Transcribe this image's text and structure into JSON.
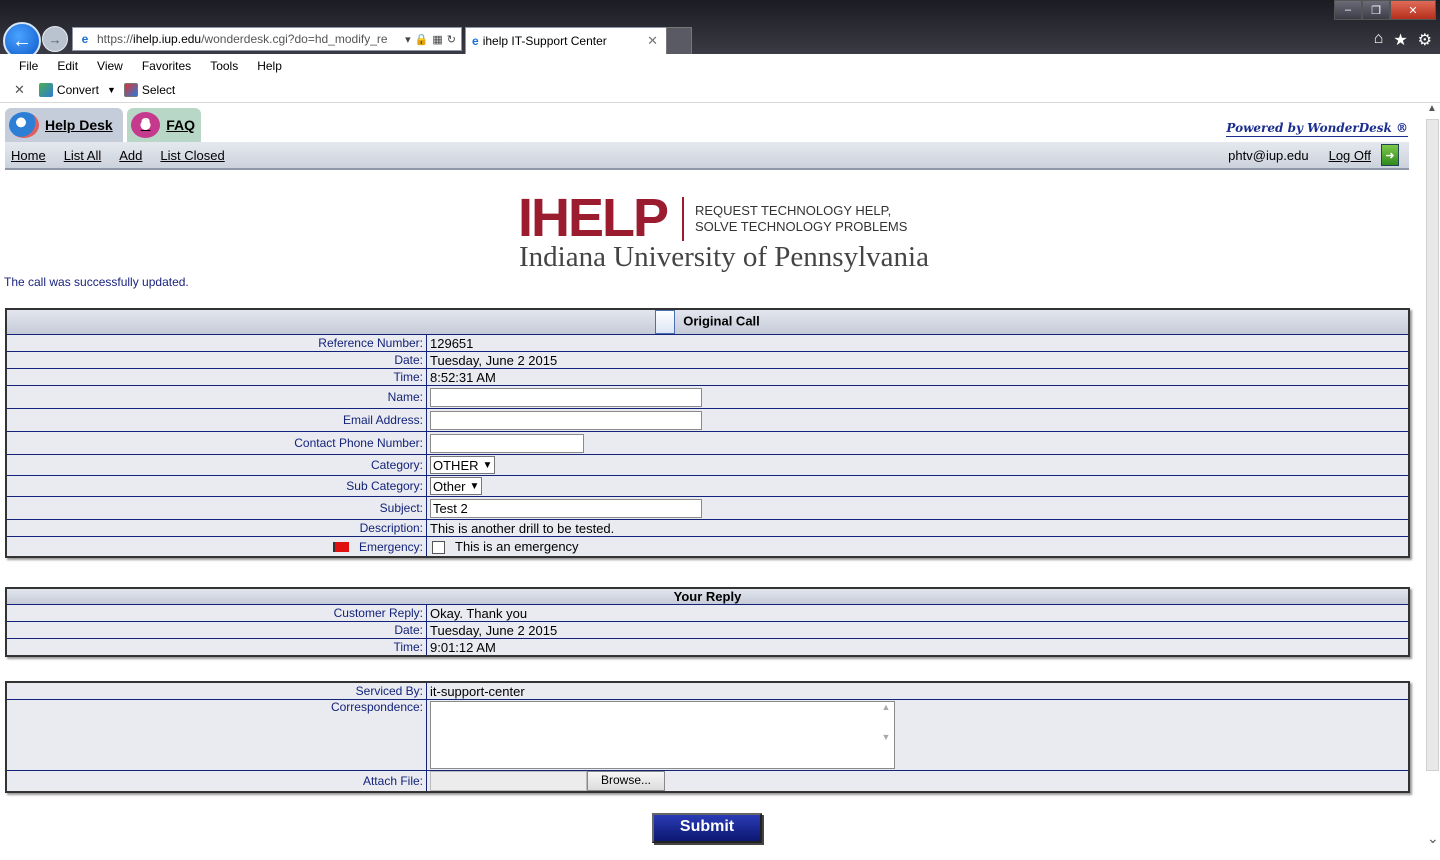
{
  "browser": {
    "url_prefix": "https://",
    "url_domain": "ihelp.iup.edu",
    "url_path": "/wonderdesk.cgi?do=hd_modify_re",
    "tab_title": "ihelp IT-Support Center",
    "menu": [
      "File",
      "Edit",
      "View",
      "Favorites",
      "Tools",
      "Help"
    ],
    "cmd": {
      "convert": "Convert",
      "select": "Select"
    }
  },
  "apptabs": {
    "helpdesk": "Help Desk",
    "faq": "FAQ"
  },
  "powered_by": "Powered by WonderDesk ®",
  "nav": {
    "home": "Home",
    "list_all": "List All",
    "add": "Add",
    "list_closed": "List Closed",
    "user": "phtv@iup.edu",
    "logoff": "Log Off"
  },
  "brand": {
    "logo": "IHELP",
    "tag1": "REQUEST TECHNOLOGY HELP,",
    "tag2": "SOLVE TECHNOLOGY PROBLEMS",
    "university": "Indiana University of Pennsylvania"
  },
  "status_message": "The call was successfully updated.",
  "original_call": {
    "title": "Original Call",
    "labels": {
      "ref": "Reference Number:",
      "date": "Date:",
      "time": "Time:",
      "name": "Name:",
      "email": "Email Address:",
      "phone": "Contact Phone Number:",
      "category": "Category:",
      "subcategory": "Sub Category:",
      "subject": "Subject:",
      "description": "Description:",
      "emergency": "Emergency:"
    },
    "ref": "129651",
    "date": "Tuesday, June 2 2015",
    "time": "8:52:31 AM",
    "name": "",
    "email": "",
    "phone": "",
    "category": "OTHER",
    "subcategory": "Other",
    "subject": "Test 2",
    "description": "This is another drill to be tested.",
    "emergency_text": "This is an emergency"
  },
  "reply": {
    "title": "Your Reply",
    "labels": {
      "customer_reply": "Customer Reply:",
      "date": "Date:",
      "time": "Time:"
    },
    "customer_reply": "Okay. Thank you",
    "date": "Tuesday, June 2 2015",
    "time": "9:01:12 AM"
  },
  "service": {
    "labels": {
      "serviced_by": "Serviced By:",
      "correspondence": "Correspondence:",
      "attach": "Attach File:"
    },
    "serviced_by": "it-support-center",
    "browse": "Browse..."
  },
  "submit": "Submit"
}
